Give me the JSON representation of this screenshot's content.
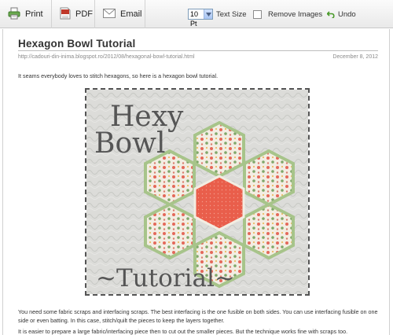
{
  "toolbar": {
    "print_label": "Print",
    "pdf_label": "PDF",
    "email_label": "Email",
    "text_size_value": "10 Pt",
    "text_size_label": "Text Size",
    "remove_images_label": "Remove Images",
    "undo_label": "Undo"
  },
  "article": {
    "title": "Hexagon Bowl Tutorial",
    "source_url": "http://cadouri-din-inima.blogspot.ro/2012/08/hexagonal-bowl-tutorial.html",
    "date": "December 8, 2012",
    "intro": "It seams everybody loves to stitch hexagons, so here is a  hexagon bowl tutorial.",
    "image_title_line1": "Hexy",
    "image_title_line2": "Bowl",
    "image_caption": "~Tutorial~",
    "para1": "You need some fabric scraps and interfacing scraps. The best interfacing is the one fusible on both sides. You can use interfacing fusible on one side or even batting. In this case, stitch/quilt the pieces to keep the layers together.",
    "para2": "It is easier to prepare a large fabric/interfacing  piece then to cut out the smaller pieces. But the technique works fine with scraps too."
  },
  "colors": {
    "toolbar_bg": "#eeeeee",
    "title_text": "#333333",
    "meta_text": "#8a8a8a",
    "undo_arrow": "#4a9a2a",
    "photo_bg": "#d9dad7",
    "hexagon_center": "#e8604d",
    "petal_fabric": "#f1ebe0",
    "petal_border": "#9fbe83"
  },
  "icons": {
    "print": "printer-icon",
    "pdf": "pdf-icon",
    "email": "envelope-icon",
    "undo": "undo-arrow-icon"
  }
}
